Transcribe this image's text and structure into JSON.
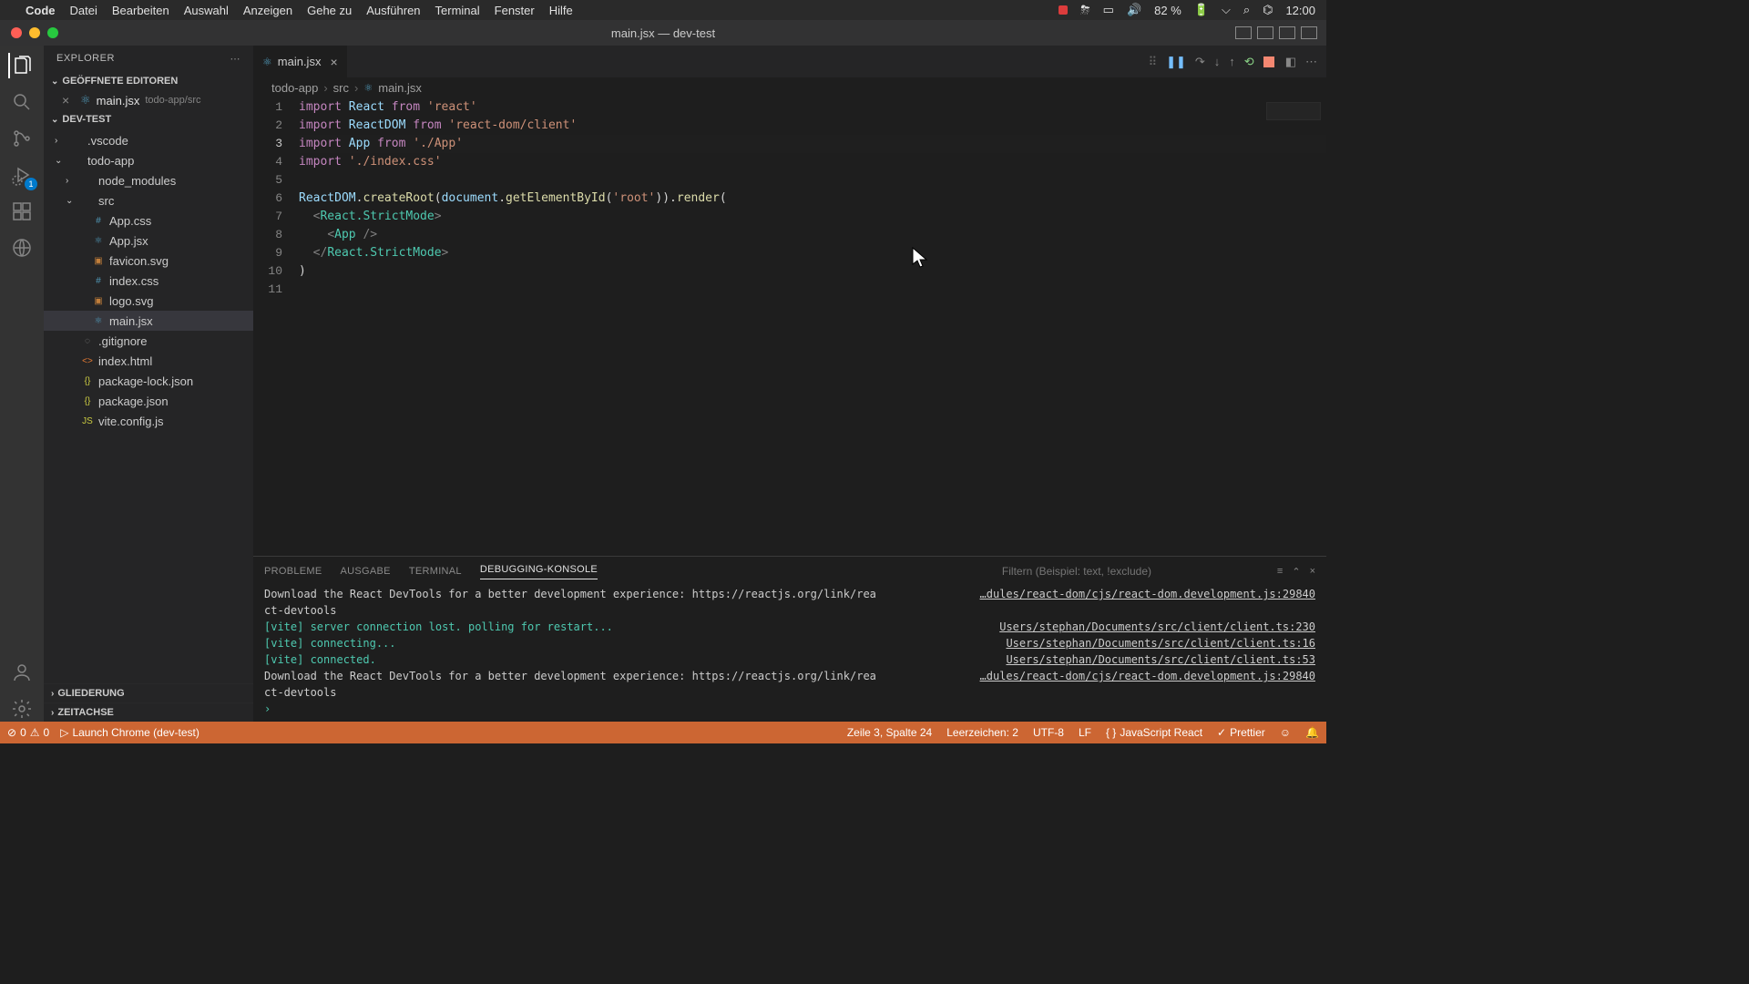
{
  "menubar": {
    "apple": "",
    "app": "Code",
    "items": [
      "Datei",
      "Bearbeiten",
      "Auswahl",
      "Anzeigen",
      "Gehe zu",
      "Ausführen",
      "Terminal",
      "Fenster",
      "Hilfe"
    ],
    "battery": "82 %",
    "time": "12:00"
  },
  "window": {
    "title": "main.jsx — dev-test"
  },
  "explorer": {
    "title": "EXPLORER",
    "openEditorsTitle": "GEÖFFNETE EDITOREN",
    "openEditor": {
      "name": "main.jsx",
      "path": "todo-app/src"
    },
    "projectTitle": "DEV-TEST",
    "outlineTitle": "GLIEDERUNG",
    "timelineTitle": "ZEITACHSE"
  },
  "tree": [
    {
      "name": ".vscode",
      "type": "folder",
      "depth": 0,
      "expanded": false
    },
    {
      "name": "todo-app",
      "type": "folder",
      "depth": 0,
      "expanded": true
    },
    {
      "name": "node_modules",
      "type": "folder",
      "depth": 1,
      "expanded": false
    },
    {
      "name": "src",
      "type": "folder",
      "depth": 1,
      "expanded": true
    },
    {
      "name": "App.css",
      "type": "css",
      "depth": 2
    },
    {
      "name": "App.jsx",
      "type": "jsx",
      "depth": 2
    },
    {
      "name": "favicon.svg",
      "type": "svg",
      "depth": 2
    },
    {
      "name": "index.css",
      "type": "css",
      "depth": 2
    },
    {
      "name": "logo.svg",
      "type": "svg",
      "depth": 2
    },
    {
      "name": "main.jsx",
      "type": "jsx",
      "depth": 2,
      "selected": true
    },
    {
      "name": ".gitignore",
      "type": "ignore",
      "depth": 1
    },
    {
      "name": "index.html",
      "type": "html",
      "depth": 1
    },
    {
      "name": "package-lock.json",
      "type": "json",
      "depth": 1
    },
    {
      "name": "package.json",
      "type": "json",
      "depth": 1
    },
    {
      "name": "vite.config.js",
      "type": "js",
      "depth": 1
    }
  ],
  "tab": {
    "name": "main.jsx"
  },
  "breadcrumb": [
    "todo-app",
    "src",
    "main.jsx"
  ],
  "code": {
    "lines": [
      [
        [
          "kw",
          "import"
        ],
        [
          "plain",
          " "
        ],
        [
          "var",
          "React"
        ],
        [
          "plain",
          " "
        ],
        [
          "kw",
          "from"
        ],
        [
          "plain",
          " "
        ],
        [
          "str",
          "'react'"
        ]
      ],
      [
        [
          "kw",
          "import"
        ],
        [
          "plain",
          " "
        ],
        [
          "var",
          "ReactDOM"
        ],
        [
          "plain",
          " "
        ],
        [
          "kw",
          "from"
        ],
        [
          "plain",
          " "
        ],
        [
          "str",
          "'react-dom/client'"
        ]
      ],
      [
        [
          "kw",
          "import"
        ],
        [
          "plain",
          " "
        ],
        [
          "var",
          "App"
        ],
        [
          "plain",
          " "
        ],
        [
          "kw",
          "from"
        ],
        [
          "plain",
          " "
        ],
        [
          "str",
          "'./App'"
        ]
      ],
      [
        [
          "kw",
          "import"
        ],
        [
          "plain",
          " "
        ],
        [
          "str",
          "'./index.css'"
        ]
      ],
      [
        [
          "plain",
          ""
        ]
      ],
      [
        [
          "var",
          "ReactDOM"
        ],
        [
          "plain",
          "."
        ],
        [
          "fn",
          "createRoot"
        ],
        [
          "plain",
          "("
        ],
        [
          "var",
          "document"
        ],
        [
          "plain",
          "."
        ],
        [
          "fn",
          "getElementById"
        ],
        [
          "plain",
          "("
        ],
        [
          "str",
          "'root'"
        ],
        [
          "plain",
          "))."
        ],
        [
          "fn",
          "render"
        ],
        [
          "plain",
          "("
        ]
      ],
      [
        [
          "plain",
          "  "
        ],
        [
          "punc",
          "<"
        ],
        [
          "tag",
          "React.StrictMode"
        ],
        [
          "punc",
          ">"
        ]
      ],
      [
        [
          "plain",
          "    "
        ],
        [
          "punc",
          "<"
        ],
        [
          "tag",
          "App"
        ],
        [
          "plain",
          " "
        ],
        [
          "punc",
          "/>"
        ]
      ],
      [
        [
          "plain",
          "  "
        ],
        [
          "punc",
          "</"
        ],
        [
          "tag",
          "React.StrictMode"
        ],
        [
          "punc",
          ">"
        ]
      ],
      [
        [
          "plain",
          ")"
        ]
      ],
      [
        [
          "plain",
          ""
        ]
      ]
    ],
    "activeLine": 3
  },
  "panel": {
    "tabs": [
      "PROBLEME",
      "AUSGABE",
      "TERMINAL",
      "DEBUGGING-KONSOLE"
    ],
    "activeTab": 3,
    "filterPlaceholder": "Filtern (Beispiel: text, !exclude)",
    "rows": [
      {
        "msg": "Download the React DevTools for a better development experience: https://reactjs.org/link/rea\nct-devtools",
        "src": "…dules/react-dom/cjs/react-dom.development.js:29840"
      },
      {
        "msg": "[vite] server connection lost. polling for restart...",
        "class": "green",
        "src": "Users/stephan/Documents/src/client/client.ts:230"
      },
      {
        "msg": "[vite] connecting...",
        "class": "green",
        "src": "Users/stephan/Documents/src/client/client.ts:16"
      },
      {
        "msg": "[vite] connected.",
        "class": "green",
        "src": "Users/stephan/Documents/src/client/client.ts:53"
      },
      {
        "msg": "Download the React DevTools for a better development experience: https://reactjs.org/link/rea\nct-devtools",
        "src": "…dules/react-dom/cjs/react-dom.development.js:29840"
      }
    ],
    "prompt": "›"
  },
  "status": {
    "errors": "0",
    "warnings": "0",
    "launch": "Launch Chrome (dev-test)",
    "position": "Zeile 3, Spalte 24",
    "spaces": "Leerzeichen: 2",
    "encoding": "UTF-8",
    "eol": "LF",
    "language": "JavaScript React",
    "prettier": "Prettier"
  },
  "debugBadge": "1"
}
